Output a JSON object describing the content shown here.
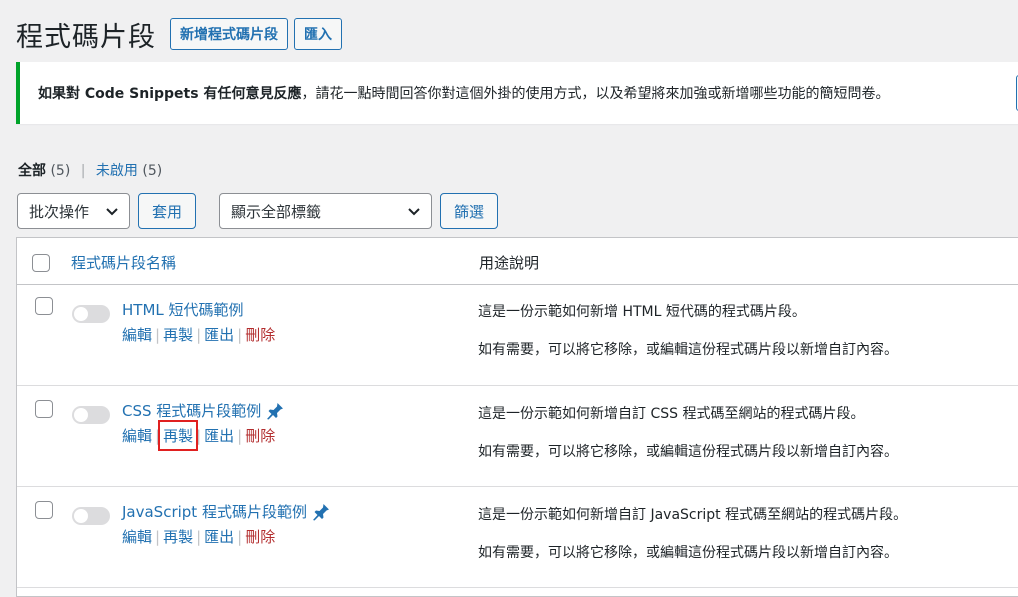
{
  "header": {
    "title": "程式碼片段",
    "add_new_label": "新增程式碼片段",
    "import_label": "匯入"
  },
  "notice": {
    "bold_text": "如果對 Code Snippets 有任何意見反應",
    "text": "，請花一點時間回答你對這個外掛的使用方式，以及希望將來加強或新增哪些功能的簡短問卷。"
  },
  "views": {
    "all_label": "全部",
    "all_count": "(5)",
    "inactive_label": "未啟用",
    "inactive_count": "(5)"
  },
  "tablenav": {
    "bulk_actions": "批次操作",
    "apply": "套用",
    "tags_filter": "顯示全部標籤",
    "filter": "篩選"
  },
  "table": {
    "col_name": "程式碼片段名稱",
    "col_desc": "用途說明",
    "actions": {
      "edit": "編輯",
      "clone": "再製",
      "export": "匯出",
      "delete": "刪除"
    },
    "rows": [
      {
        "name": "HTML 短代碼範例",
        "desc1": "這是一份示範如何新增 HTML 短代碼的程式碼片段。",
        "desc2": "如有需要，可以將它移除，或編輯這份程式碼片段以新增自訂內容。"
      },
      {
        "name": "CSS 程式碼片段範例",
        "desc1": "這是一份示範如何新增自訂 CSS 程式碼至網站的程式碼片段。",
        "desc2": "如有需要，可以將它移除，或編輯這份程式碼片段以新增自訂內容。"
      },
      {
        "name": "JavaScript 程式碼片段範例",
        "desc1": "這是一份示範如何新增自訂 JavaScript 程式碼至網站的程式碼片段。",
        "desc2": "如有需要，可以將它移除，或編輯這份程式碼片段以新增自訂內容。"
      }
    ]
  },
  "colors": {
    "link": "#2271b1",
    "delete": "#b32d2e",
    "notice_border": "#00a32a",
    "highlight": "#e02020"
  }
}
